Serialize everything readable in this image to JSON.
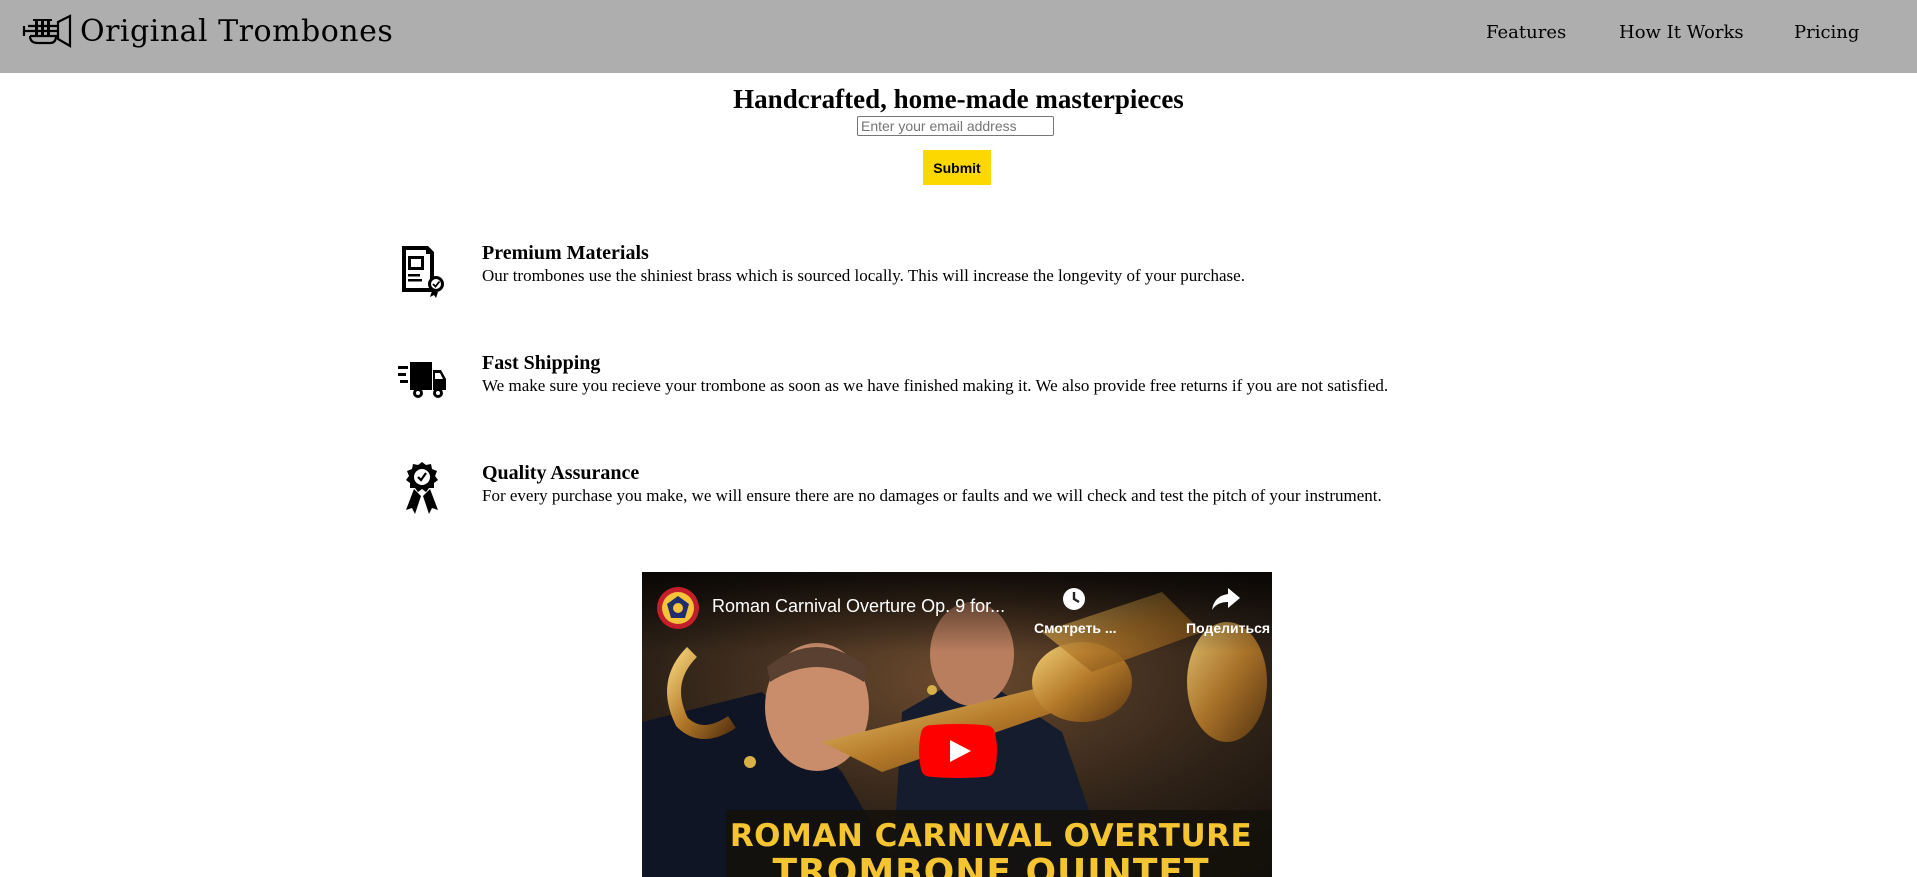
{
  "header": {
    "logo_text": "Original Trombones",
    "logo_icon": "trumpet-icon",
    "nav": [
      {
        "label": "Features"
      },
      {
        "label": "How It Works"
      },
      {
        "label": "Pricing"
      }
    ]
  },
  "hero": {
    "title": "Handcrafted, home-made masterpieces",
    "email_placeholder": "Enter your email address",
    "submit_label": "Submit"
  },
  "features": [
    {
      "icon": "certificate-document-icon",
      "title": "Premium Materials",
      "description": "Our trombones use the shiniest brass which is sourced locally. This will increase the longevity of your purchase."
    },
    {
      "icon": "delivery-truck-icon",
      "title": "Fast Shipping",
      "description": "We make sure you recieve your trombone as soon as we have finished making it. We also provide free returns if you are not satisfied."
    },
    {
      "icon": "award-ribbon-icon",
      "title": "Quality Assurance",
      "description": "For every purchase you make, we will ensure there are no damages or faults and we will check and test the pitch of your instrument."
    }
  ],
  "video": {
    "title": "Roman Carnival Overture Op. 9 for...",
    "watch_later_label": "Смотреть ...",
    "share_label": "Поделиться",
    "overlay_line1": "ROMAN CARNIVAL OVERTURE",
    "overlay_line2": "TROMBONE QUINTET"
  },
  "colors": {
    "header_bg": "#afaeaf",
    "submit_bg": "#fcd700",
    "overlay_text": "#f5c531",
    "play_button": "#ff0000"
  }
}
